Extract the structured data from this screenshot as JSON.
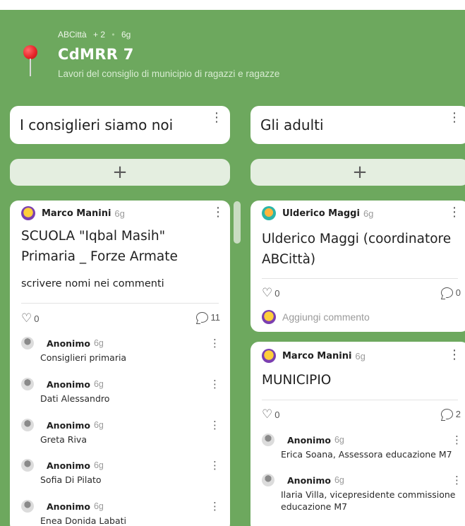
{
  "header": {
    "owner": "ABCittà",
    "plus_count": "+ 2",
    "separator": "•",
    "age": "6g",
    "title": "CdMRR 7",
    "subtitle": "Lavori del consiglio di municipio di ragazzi e ragazze"
  },
  "columns": [
    {
      "title": "I consiglieri siamo noi",
      "add_label": "+",
      "posts": [
        {
          "author": "Marco Manini",
          "time": "6g",
          "title": "SCUOLA \"Iqbal Masih\" Primaria _ Forze Armate",
          "body": "scrivere nomi nei commenti",
          "likes": "0",
          "comments_count": "11",
          "comments": [
            {
              "name": "Anonimo",
              "time": "6g",
              "text": "Consiglieri primaria"
            },
            {
              "name": "Anonimo",
              "time": "6g",
              "text": "Dati Alessandro"
            },
            {
              "name": "Anonimo",
              "time": "6g",
              "text": "Greta Riva"
            },
            {
              "name": "Anonimo",
              "time": "6g",
              "text": "Sofia Di Pilato"
            },
            {
              "name": "Anonimo",
              "time": "6g",
              "text": "Enea Donida Labati"
            }
          ]
        }
      ]
    },
    {
      "title": "Gli adulti",
      "add_label": "+",
      "posts": [
        {
          "author": "Ulderico Maggi",
          "time": "6g",
          "title": "Ulderico Maggi (coordinatore ABCittà)",
          "likes": "0",
          "comments_count": "0",
          "add_comment": "Aggiungi commento"
        },
        {
          "author": "Marco Manini",
          "time": "6g",
          "title": "MUNICIPIO",
          "likes": "0",
          "comments_count": "2",
          "comments": [
            {
              "name": "Anonimo",
              "time": "6g",
              "text": "Erica Soana, Assessora educazione M7"
            },
            {
              "name": "Anonimo",
              "time": "6g",
              "text": "Ilaria Villa, vicepresidente commissione educazione M7"
            }
          ]
        }
      ]
    }
  ],
  "colors": {
    "background": "#6da85e",
    "card": "#ffffff",
    "add_bar": "#e4eee0"
  },
  "icons": [
    "pushpin-icon",
    "kebab-menu-icon",
    "heart-icon",
    "comment-bubble-icon",
    "avatar-icon"
  ]
}
